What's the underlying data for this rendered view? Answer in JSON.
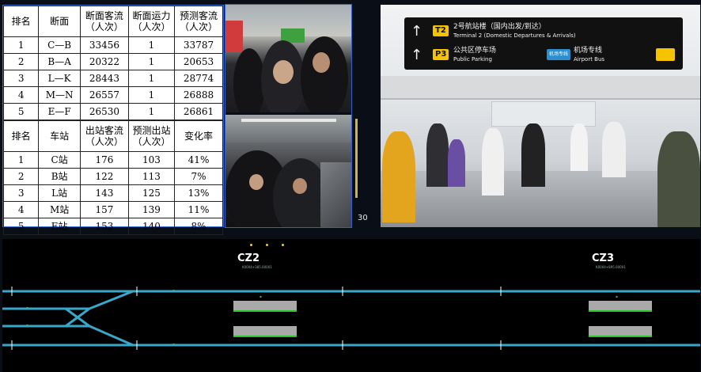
{
  "table1": {
    "headers": [
      "排名",
      "断面",
      "断面客流\n（人次）",
      "断面运力\n（人次）",
      "预测客流\n（人次）"
    ],
    "rows": [
      [
        "1",
        "C—B",
        "33456",
        "1",
        "33787"
      ],
      [
        "2",
        "B—A",
        "20322",
        "1",
        "20653"
      ],
      [
        "3",
        "L—K",
        "28443",
        "1",
        "28774"
      ],
      [
        "4",
        "M—N",
        "26557",
        "1",
        "26888"
      ],
      [
        "5",
        "E—F",
        "26530",
        "1",
        "26861"
      ]
    ]
  },
  "table2": {
    "headers": [
      "排名",
      "车站",
      "出站客流\n（人次）",
      "预测出站\n（人次）",
      "变化率"
    ],
    "rows": [
      [
        "1",
        "C站",
        "176",
        "103",
        "41%"
      ],
      [
        "2",
        "B站",
        "122",
        "113",
        "7%"
      ],
      [
        "3",
        "L站",
        "143",
        "125",
        "13%"
      ],
      [
        "4",
        "M站",
        "157",
        "139",
        "11%"
      ],
      [
        "5",
        "E站",
        "153",
        "140",
        "8%"
      ]
    ]
  },
  "signage": {
    "row1_badge": "T2",
    "row1_text_cn": "2号航站楼（国内出发/到达）",
    "row1_text_en": "Terminal 2 (Domestic Departures & Arrivals)",
    "row2_badge": "P3",
    "row2_text_cn": "公共区停车场",
    "row2_text_en": "Public Parking",
    "row2_bus_tag": "机场专线",
    "row2_bus_cn": "机场专线",
    "row2_bus_en": "Airport Bus"
  },
  "video_counter": "30",
  "track": {
    "stations": [
      {
        "name": "CZ2",
        "sub": "K0004+385.00001"
      },
      {
        "name": "CZ3",
        "sub": "K0004+895.00001"
      }
    ]
  },
  "colors": {
    "track_line": "#3aa6c9",
    "platform_edge": "#2ec22e",
    "table_border": "#3a6fd0"
  }
}
